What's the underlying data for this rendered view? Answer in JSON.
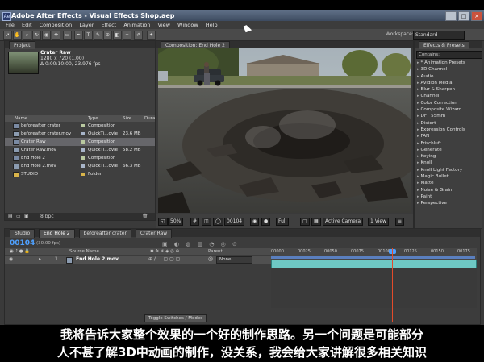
{
  "window": {
    "title": "Adobe After Effects - Visual Effects Shop.aep"
  },
  "menu": [
    "File",
    "Edit",
    "Composition",
    "Layer",
    "Effect",
    "Animation",
    "View",
    "Window",
    "Help"
  ],
  "workspace": {
    "label": "Workspace:",
    "value": "Standard"
  },
  "project": {
    "tab": "Project",
    "selected_name": "Crater Raw",
    "selected_info_1": "1280 x 720 (1.00)",
    "selected_info_2": "Δ 0:00:10:00, 23.976 fps",
    "columns": {
      "name": "Name",
      "type": "Type",
      "size": "Size",
      "duration": "Dura"
    },
    "items": [
      {
        "name": "beforeafter crater",
        "type": "Composition",
        "size": ""
      },
      {
        "name": "beforeafter crater.mov",
        "type": "QuickTi...ovie",
        "size": "23.6 MB"
      },
      {
        "name": "Crater Raw",
        "type": "Composition",
        "size": ""
      },
      {
        "name": "Crater Raw.mov",
        "type": "QuickTi...ovie",
        "size": "58.2 MB"
      },
      {
        "name": "End Hole 2",
        "type": "Composition",
        "size": ""
      },
      {
        "name": "End Hole 2.mov",
        "type": "QuickTi...ovie",
        "size": "66.3 MB"
      },
      {
        "name": "STUDIO",
        "type": "Folder",
        "size": ""
      }
    ],
    "bpc": "8 bpc"
  },
  "composition": {
    "tab": "Composition: End Hole 2",
    "zoom": "50%",
    "timecode": "00104",
    "resolution": "Full",
    "camera": "Active Camera",
    "views": "1 View"
  },
  "effects": {
    "tab": "Effects & Presets",
    "contains": "Contains:",
    "items": [
      "* Animation Presets",
      "3D Channel",
      "Audio",
      "Avidion Media",
      "Blur & Sharpen",
      "Channel",
      "Color Correction",
      "Composite Wizard",
      "DFT 55mm",
      "Distort",
      "Expression Controls",
      "FAN",
      "Frischluft",
      "Generate",
      "Keying",
      "Knoll",
      "Knoll Light Factory",
      "Magic Bullet",
      "Matte",
      "Noise & Grain",
      "Paint",
      "Perspective"
    ]
  },
  "timeline": {
    "tabs": [
      "Studio",
      "End Hole 2",
      "beforeafter crater",
      "Crater Raw"
    ],
    "timecode": "00104",
    "fps": "(30.00 fps)",
    "source_header": "Source Name",
    "parent_header": "Parent",
    "layer": {
      "index": "1",
      "name": "End Hole 2.mov",
      "parent": "None"
    },
    "ruler_ticks": [
      "00000",
      "00025",
      "00050",
      "00075",
      "00100",
      "00125",
      "00150",
      "00175"
    ],
    "playhead_frame": 104,
    "toggle_label": "Toggle Switches / Modes"
  },
  "subtitles": [
    "我将告诉大家整个效果的一个好的制作思路。另一个问题是可能部分",
    "人不甚了解3D中动画的制作，没关系，我会给大家讲解很多相关知识"
  ]
}
